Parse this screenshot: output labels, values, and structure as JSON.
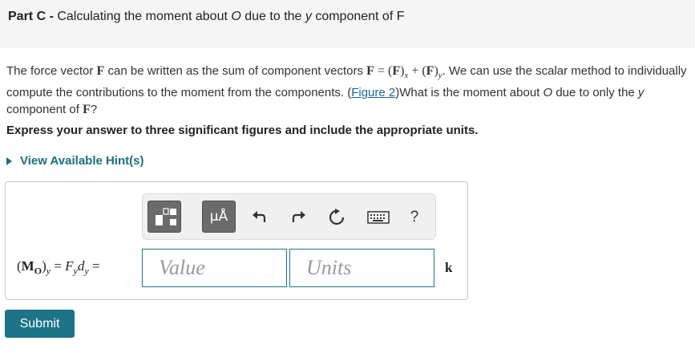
{
  "header": {
    "part_label": "Part C",
    "separator": " - ",
    "title_pre": "Calculating the moment about ",
    "title_o": "O",
    "title_mid": " due to the ",
    "title_y": "y",
    "title_post": " component of F"
  },
  "description": {
    "text1": "The force vector ",
    "F1": "F",
    "text2": " can be written as the sum of component vectors ",
    "F2": "F",
    "eq": " = (",
    "F3": "F",
    "x_close": ")",
    "x_sub": "x",
    "plus": " + (",
    "F4": "F",
    "y_close": ")",
    "y_sub": "y",
    "text3": ". We can use the scalar method to individually compute the contributions to the moment from the components. (",
    "figure_link": "Figure 2",
    "text4": ")What is the moment about ",
    "O": "O",
    "text5": " due to only the ",
    "y": "y",
    "text6": " component of ",
    "F5": "F",
    "text7": "?"
  },
  "instruction": "Express your answer to three significant figures and include the appropriate units.",
  "hint_label": "View Available Hint(s)",
  "toolbar": {
    "mu_label": "μÅ",
    "undo_icon": "undo-icon",
    "redo_icon": "redo-icon",
    "reset_icon": "reset-icon",
    "keyboard_icon": "keyboard-icon",
    "help_label": "?"
  },
  "equation": {
    "lhs_M": "M",
    "lhs_O": "O",
    "lhs_y": "y",
    "rhs_F": "F",
    "rhs_Fy": "y",
    "rhs_d": "d",
    "rhs_dy": "y",
    "equals": " = "
  },
  "value_placeholder": "Value",
  "units_placeholder": "Units",
  "unit_suffix": "k",
  "submit_label": "Submit"
}
